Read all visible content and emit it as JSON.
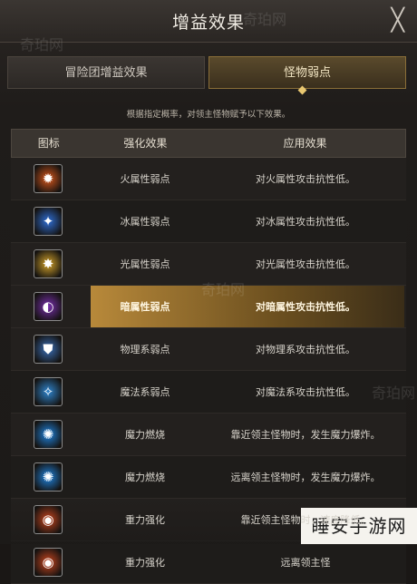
{
  "title": "增益效果",
  "close_label": "╳",
  "tabs": [
    {
      "label": "冒险团增益效果",
      "active": false
    },
    {
      "label": "怪物弱点",
      "active": true
    }
  ],
  "note": "根据指定概率，对领主怪物赋予以下效果。",
  "headers": {
    "icon": "图标",
    "effect": "强化效果",
    "apply": "应用效果"
  },
  "rows": [
    {
      "icon": "fire-icon",
      "effect": "火属性弱点",
      "apply": "对火属性攻击抗性低。",
      "color": "#d8571c"
    },
    {
      "icon": "ice-icon",
      "effect": "冰属性弱点",
      "apply": "对冰属性攻击抗性低。",
      "color": "#2f6fd6"
    },
    {
      "icon": "light-icon",
      "effect": "光属性弱点",
      "apply": "对光属性攻击抗性低。",
      "color": "#d4a32a"
    },
    {
      "icon": "dark-icon",
      "effect": "暗属性弱点",
      "apply": "对暗属性攻击抗性低。",
      "color": "#7a2fb0",
      "highlight": true
    },
    {
      "icon": "physical-shield-icon",
      "effect": "物理系弱点",
      "apply": "对物理系攻击抗性低。",
      "color": "#3a6fb8"
    },
    {
      "icon": "magic-icon",
      "effect": "魔法系弱点",
      "apply": "对魔法系攻击抗性低。",
      "color": "#2f86d0"
    },
    {
      "icon": "magic-burn-in-icon",
      "effect": "魔力燃烧",
      "apply": "靠近领主怪物时，发生魔力爆炸。",
      "color": "#1f84e0"
    },
    {
      "icon": "magic-burn-out-icon",
      "effect": "魔力燃烧",
      "apply": "远离领主怪物时，发生魔力爆炸。",
      "color": "#1f84e0"
    },
    {
      "icon": "gravity-in-icon",
      "effect": "重力强化",
      "apply": "靠近领主怪物时，速度降低。",
      "color": "#c9451e"
    },
    {
      "icon": "gravity-out-icon",
      "effect": "重力强化",
      "apply": "远离领主怪",
      "color": "#c9451e"
    }
  ],
  "watermark": "奇珀网",
  "site_label": "睡安手游网"
}
